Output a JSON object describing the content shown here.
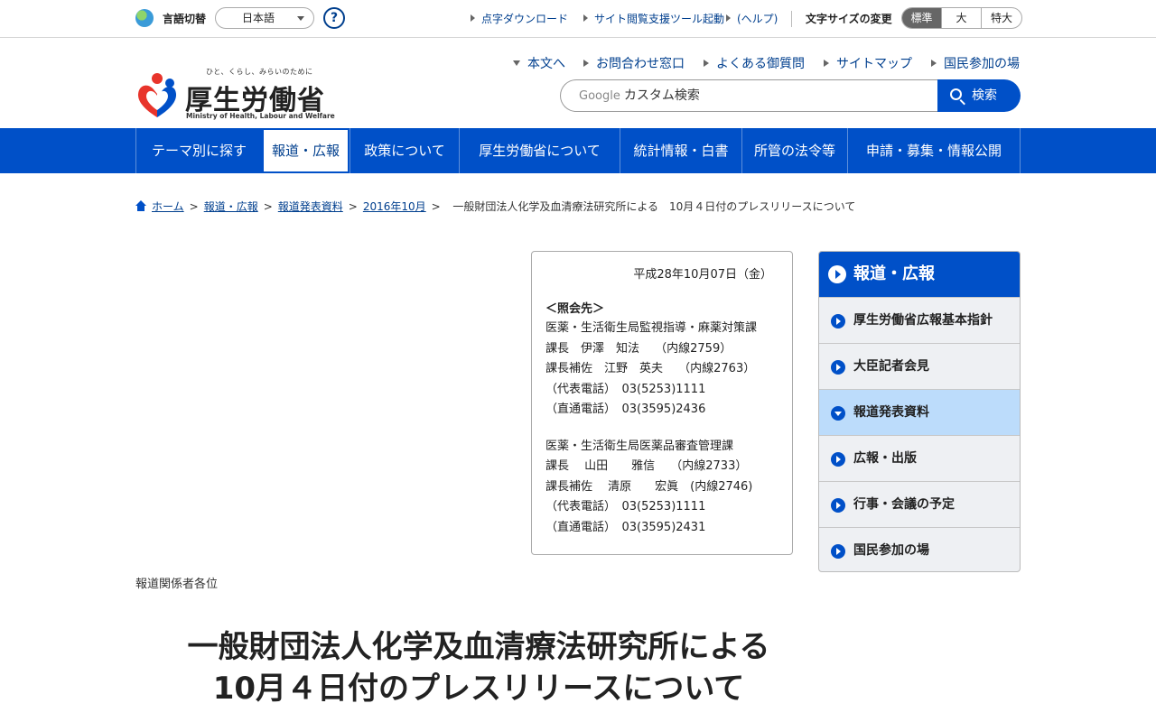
{
  "utility": {
    "language_label": "言語切替",
    "language_value": "日本語",
    "help_label": "?",
    "braille_download": "点字ダウンロード",
    "accessibility_tool": "サイト閲覧支援ツール起動",
    "accessibility_help": "(ヘルプ)",
    "font_size_label": "文字サイズの変更",
    "font_sizes": [
      "標準",
      "大",
      "特大"
    ],
    "font_size_selected": "標準"
  },
  "header": {
    "logo_tagline": "ひと、くらし、みらいのために",
    "logo_name": "厚生労働省",
    "logo_en": "Ministry of Health, Labour and Welfare",
    "links": [
      "本文へ",
      "お問合わせ窓口",
      "よくある御質問",
      "サイトマップ",
      "国民参加の場"
    ],
    "search_google": "Google",
    "search_placeholder": "カスタム検索",
    "search_button": "検索"
  },
  "gnav": {
    "items": [
      "テーマ別に探す",
      "報道・広報",
      "政策について",
      "厚生労働省について",
      "統計情報・白書",
      "所管の法令等",
      "申請・募集・情報公開"
    ],
    "active": "報道・広報"
  },
  "breadcrumb": {
    "items": [
      "ホーム",
      "報道・広報",
      "報道発表資料",
      "2016年10月"
    ],
    "current": "一般財団法人化学及血清療法研究所による　10月４日付のプレスリリースについて"
  },
  "contact": {
    "date": "平成28年10月07日（金）",
    "heading": "＜照会先＞",
    "section1": {
      "dept": "医薬・生活衛生局監視指導・麻薬対策課",
      "line1": "課長　伊澤　知法　 （内線2759）",
      "line2": "課長補佐　江野　英夫　 （内線2763）",
      "line3": "（代表電話）　03(5253)1111",
      "line4": "（直通電話）　03(3595)2436"
    },
    "section2": {
      "dept": "医薬・生活衛生局医薬品審査管理課",
      "line1": "課長　 山田　　雅信　 （内線2733）",
      "line2": "課長補佐　 清原　　宏眞　(内線2746)",
      "line3": "（代表電話）　03(5253)1111",
      "line4": "（直通電話）　03(3595)2431"
    }
  },
  "side_menu": {
    "heading": "報道・広報",
    "items": [
      "厚生労働省広報基本指針",
      "大臣記者会見",
      "報道発表資料",
      "広報・出版",
      "行事・会議の予定",
      "国民参加の場"
    ],
    "current": "報道発表資料"
  },
  "main": {
    "addressee": "報道関係者各位",
    "title_line1": "一般財団法人化学及血清療法研究所による",
    "title_line2": "10月４日付のプレスリリースについて"
  },
  "colors": {
    "brand_blue": "#0050c8",
    "link_blue": "#003f8e",
    "current_item_bg": "#bcdcfb"
  }
}
